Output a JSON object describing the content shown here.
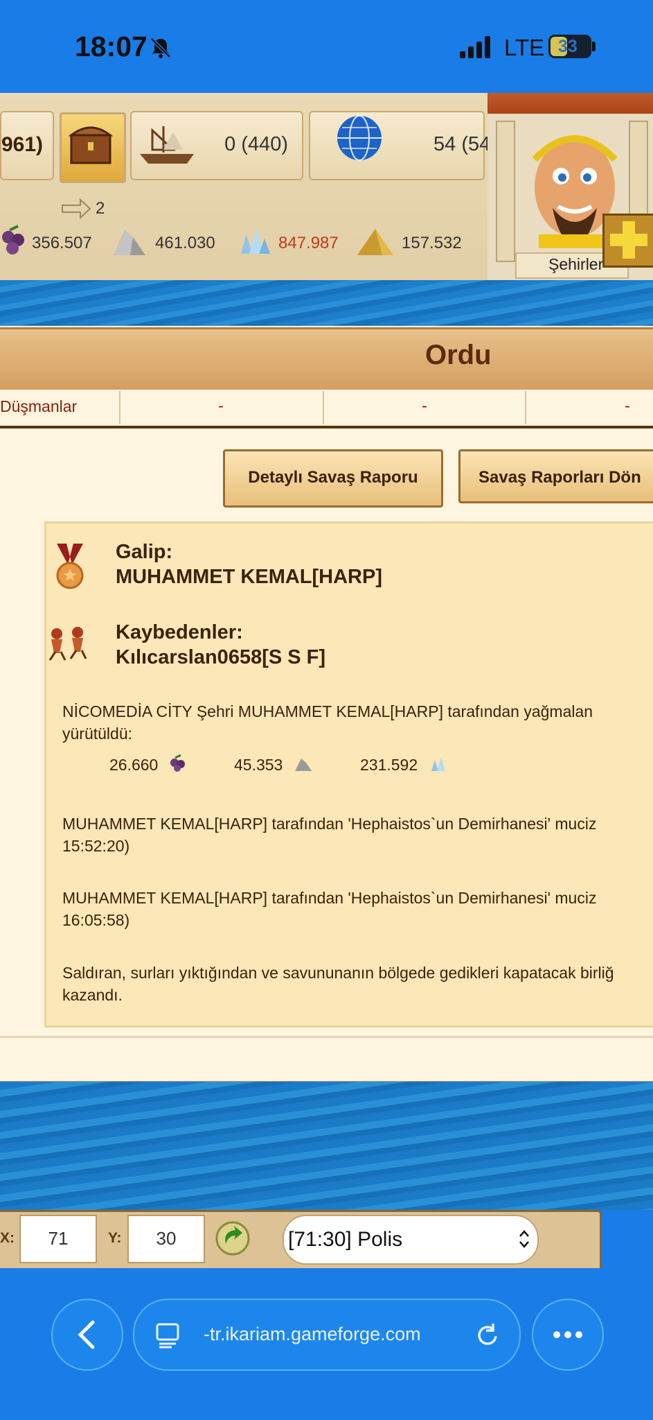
{
  "status_bar": {
    "time": "18:07",
    "network": "LTE",
    "battery": "33"
  },
  "header": {
    "gold_partial": "961)",
    "ships": "0 (440)",
    "world": "54 (54",
    "arrows_count": "2",
    "wine": "356.507",
    "marble": "461.030",
    "crystal": "847.987",
    "sulfur": "157.532",
    "advisor_label": "Şehirler",
    "crystal_color": "#c0391d"
  },
  "army": {
    "title": "Ordu",
    "enemies_label": "Düşmanlar",
    "cells": [
      "-",
      "-",
      "-"
    ]
  },
  "buttons": {
    "detailed_report": "Detaylı Savaş Raporu",
    "reports_back": "Savaş Raporları Dön"
  },
  "report": {
    "winner_label": "Galip:",
    "winner_name": "MUHAMMET KEMAL[HARP]",
    "losers_label": "Kaybedenler:",
    "loser_name": "Kılıcarslan0658[S S F]",
    "plunder_line1": "NİCOMEDİA CİTY Şehri MUHAMMET KEMAL[HARP] tarafından yağmalan",
    "plunder_line2": "yürütüldü:",
    "loot_wine": "26.660",
    "loot_marble": "45.353",
    "loot_crystal": "231.592",
    "event1_line1": "MUHAMMET KEMAL[HARP] tarafından 'Hephaistos`un Demirhanesi' muciz",
    "event1_line2": "15:52:20)",
    "event2_line1": "MUHAMMET KEMAL[HARP] tarafından 'Hephaistos`un Demirhanesi' muciz",
    "event2_line2": "16:05:58)",
    "wall_line1": "Saldıran, surları yıktığından ve savununanın bölgede gedikleri kapatacak birliğ",
    "wall_line2": "kazandı."
  },
  "coords": {
    "x_label": "X:",
    "x_value": "71",
    "y_label": "Y:",
    "y_value": "30",
    "select_value": "[71:30] Polis"
  },
  "browser": {
    "url": "-tr.ikariam.gameforge.com"
  }
}
